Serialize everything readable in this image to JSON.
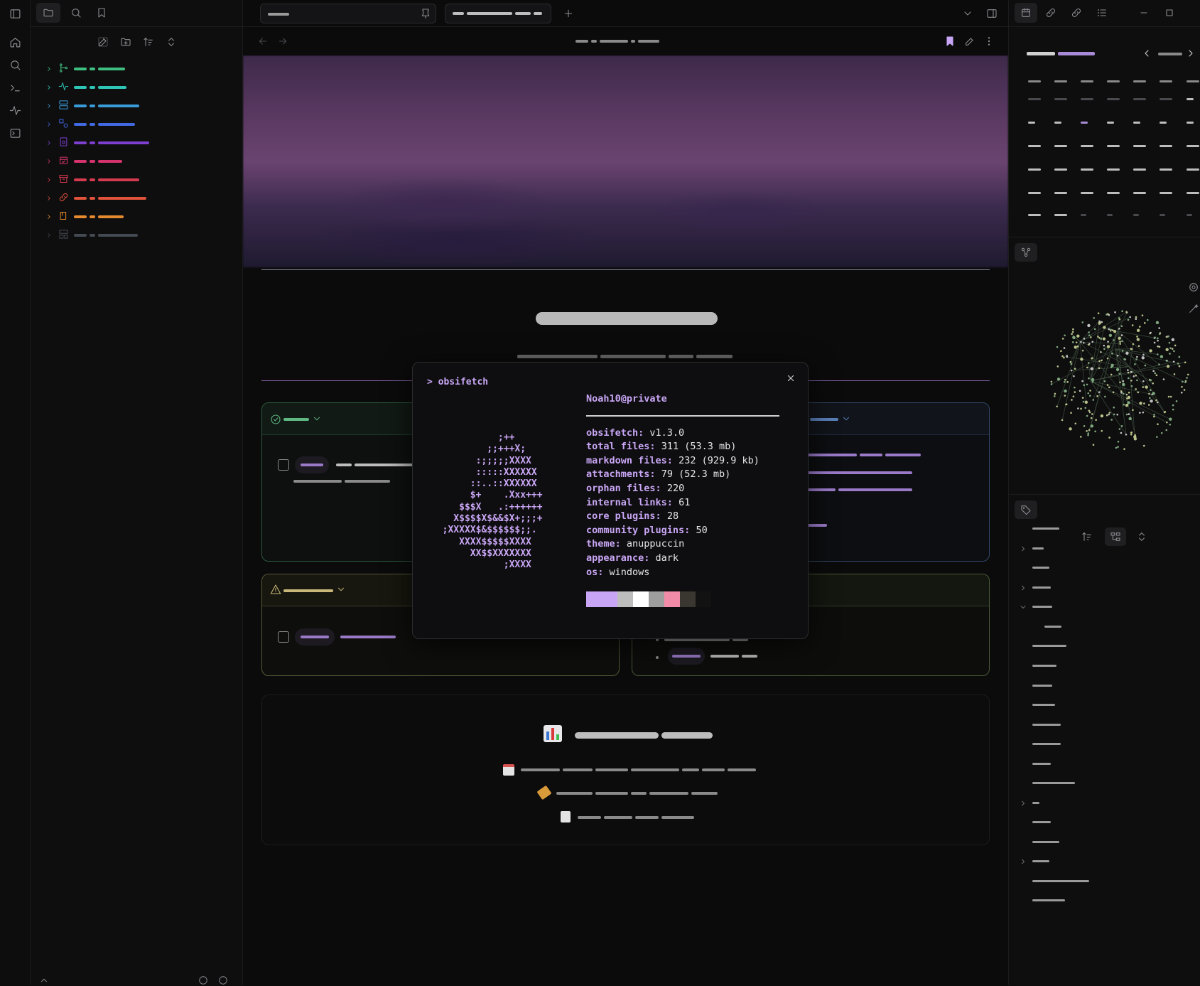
{
  "obsifetch": {
    "command": "> obsifetch",
    "host": "Noah10@private",
    "ascii_art": "            ;++\n          ;;+++X;\n        :;;;;;XXXX\n        :::::XXXXXX\n       ::..::XXXXXX\n       $+    .Xxx+++\n     $$$X   .:++++++\n    X$$$$X$&&$X+;;;+\n  ;XXXXX$&$$$$$$;;.\n     XXXX$$$$$XXXX\n       XX$$XXXXXXX\n             ;XXXX",
    "rows": [
      {
        "key": "obsifetch:",
        "value": "v1.3.0"
      },
      {
        "key": "total files:",
        "value": "311 (53.3 mb)"
      },
      {
        "key": "markdown files:",
        "value": "232 (929.9 kb)"
      },
      {
        "key": "attachments:",
        "value": "79 (52.3 mb)"
      },
      {
        "key": "orphan files:",
        "value": "220"
      },
      {
        "key": "internal links:",
        "value": "61"
      },
      {
        "key": "core plugins:",
        "value": "28"
      },
      {
        "key": "community plugins:",
        "value": "50"
      },
      {
        "key": "theme:",
        "value": "anuppuccin"
      },
      {
        "key": "appearance:",
        "value": "dark"
      },
      {
        "key": "os:",
        "value": "windows"
      }
    ],
    "palette": [
      "#c9a6f5",
      "#c9a6f5",
      "#bdbdbd",
      "#ffffff",
      "#9e9e9e",
      "#f28ba8",
      "#3a3630",
      "#121212"
    ]
  },
  "explorer": {
    "folders": [
      {
        "icon": "git-icon",
        "color": "#3fbf7f"
      },
      {
        "icon": "activity-icon",
        "color": "#2ec4b6"
      },
      {
        "icon": "database-icon",
        "color": "#3a9bd9"
      },
      {
        "icon": "shapes-icon",
        "color": "#4169e1"
      },
      {
        "icon": "file-icon",
        "color": "#7e3fd1"
      },
      {
        "icon": "calendar-icon",
        "color": "#d6336c"
      },
      {
        "icon": "archive-icon",
        "color": "#d63a4f"
      },
      {
        "icon": "link-icon",
        "color": "#e0533a"
      },
      {
        "icon": "book-icon",
        "color": "#e68a2e"
      },
      {
        "icon": "layout-icon",
        "color": "#444a52"
      }
    ]
  },
  "colors": {
    "accent": "#c9a6f5",
    "green_card": "#2c5a3e",
    "blue_card": "#324868",
    "yellow_card": "#5a5a38"
  }
}
